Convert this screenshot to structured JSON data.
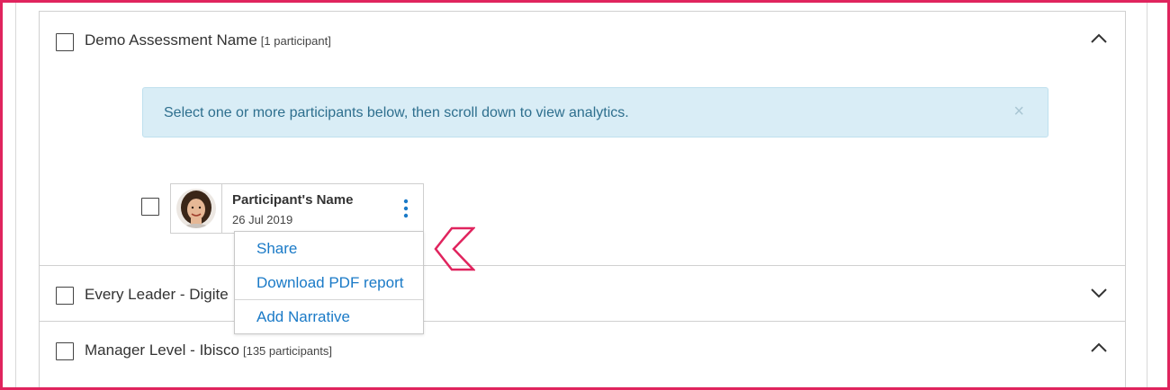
{
  "assessments": [
    {
      "name": "Demo Assessment Name",
      "count": "[1 participant]",
      "expanded": true
    },
    {
      "name": "Every Leader - Digite",
      "count": "",
      "expanded": false
    },
    {
      "name": "Manager Level - Ibisco",
      "count": "[135 participants]",
      "expanded": true
    }
  ],
  "alert": {
    "message": "Select one or more participants below, then scroll down to view analytics.",
    "close_icon": "×"
  },
  "participant": {
    "name": "Participant's Name",
    "date": "26 Jul 2019"
  },
  "context_menu": {
    "items": [
      "Share",
      "Download PDF report",
      "Add Narrative"
    ]
  },
  "colors": {
    "frame": "#e0245e",
    "link": "#1a7ac7",
    "alert_bg": "#d9edf6",
    "alert_text": "#2e6f8e"
  }
}
